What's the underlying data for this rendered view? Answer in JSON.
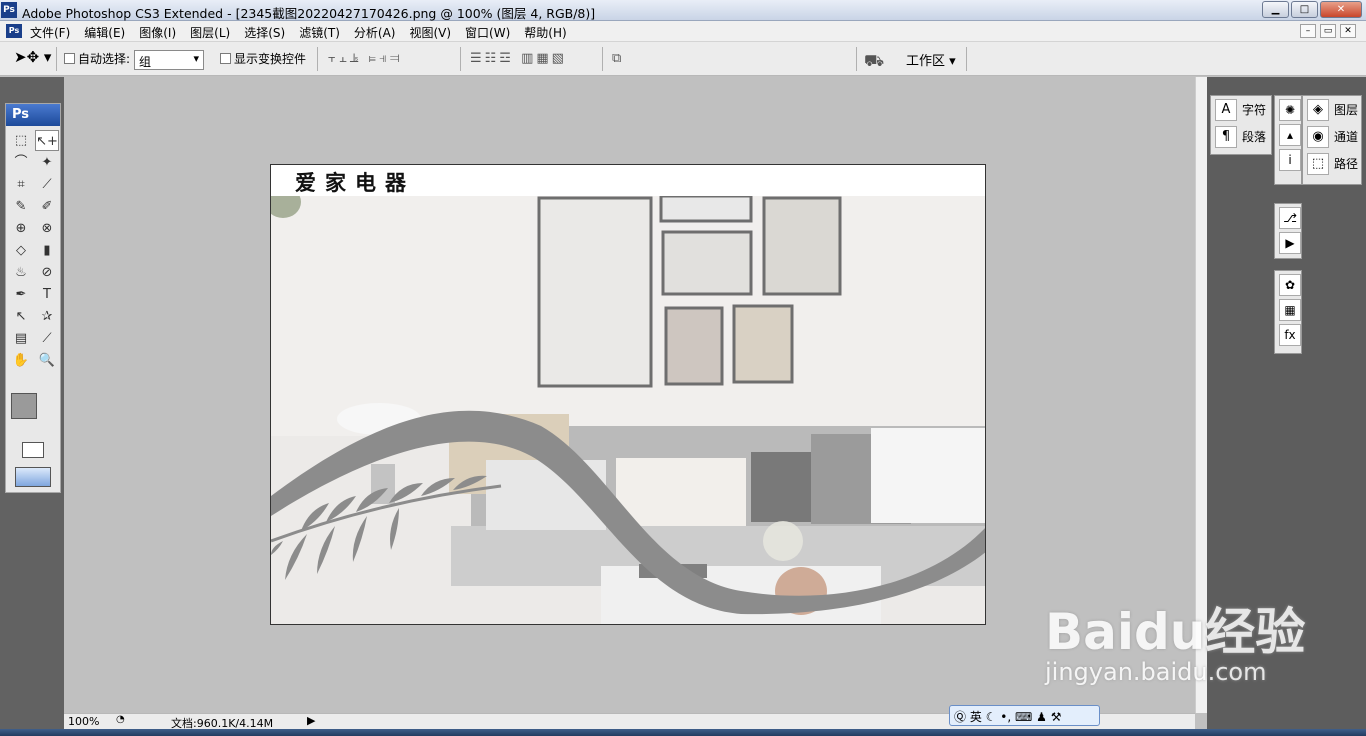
{
  "window": {
    "title": "Adobe Photoshop CS3 Extended - [2345截图20220427170426.png @ 100% (图层 4, RGB/8)]",
    "app_icon": "Ps",
    "minimize": "▁",
    "maximize": "□",
    "close": "✕"
  },
  "menubar": {
    "items": [
      "文件(F)",
      "编辑(E)",
      "图像(I)",
      "图层(L)",
      "选择(S)",
      "滤镜(T)",
      "分析(A)",
      "视图(V)",
      "窗口(W)",
      "帮助(H)"
    ],
    "doc_min": "–",
    "doc_restore": "▭",
    "doc_close": "✕"
  },
  "options": {
    "auto_select_label": "自动选择:",
    "auto_select_value": "组",
    "show_transform_label": "显示变换控件",
    "workspace_label": "工作区 ▾"
  },
  "toolbox": {
    "logo": "Ps",
    "tools": [
      "⬚",
      "↖+",
      "⌒",
      "✦",
      "⌗",
      "⟋",
      "✎",
      "✐",
      "⊕",
      "⊗",
      "◇",
      "▮",
      "♨",
      "⊘",
      "✒",
      "T",
      "↖",
      "✰",
      "▤",
      "⟋",
      "✋",
      "🔍"
    ]
  },
  "document": {
    "brand_text": "爱家电器"
  },
  "status": {
    "zoom": "100%",
    "doc_info": "文档:960.1K/4.14M"
  },
  "panels": {
    "type_panel": [
      {
        "icon": "A",
        "label": "字符"
      },
      {
        "icon": "¶",
        "label": "段落"
      }
    ],
    "layers_panel": [
      {
        "icon": "◈",
        "label": "图层"
      },
      {
        "icon": "◉",
        "label": "通道"
      },
      {
        "icon": "⬚",
        "label": "路径"
      }
    ],
    "side_icons": [
      "✺",
      "▴",
      "i",
      "⎇",
      "▶",
      "✿",
      "▦",
      "fx"
    ]
  },
  "ime": {
    "text": "英"
  },
  "watermark": {
    "line1": "Baidu经验",
    "line2": "jingyan.baidu.com"
  }
}
